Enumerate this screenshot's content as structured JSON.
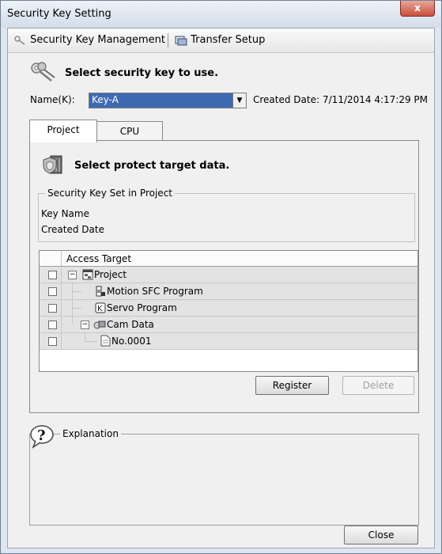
{
  "window": {
    "title": "Security Key Setting",
    "close_glyph": "x"
  },
  "toolbar": {
    "items": [
      {
        "label": "Security Key Management",
        "icon": "key-icon"
      },
      {
        "label": "Transfer Setup",
        "icon": "transfer-icon"
      }
    ]
  },
  "key_section": {
    "heading": "Select security key to use.",
    "name_label": "Name(K):",
    "name_value": "Key-A",
    "created_label": "Created Date:",
    "created_value": "7/11/2014 4:17:29 PM"
  },
  "tabs": [
    {
      "label": "Project",
      "selected": true
    },
    {
      "label": "CPU",
      "selected": false
    }
  ],
  "project_tab": {
    "heading": "Select protect target data.",
    "group_title": "Security Key Set in Project",
    "key_name_label": "Key Name",
    "created_date_label": "Created Date",
    "tree_header": "Access Target",
    "tree_rows": [
      {
        "label": "Project",
        "level": 0,
        "expander": "−",
        "icon": "project-icon"
      },
      {
        "label": "Motion SFC Program",
        "level": 1,
        "expander": "",
        "icon": "sfc-icon"
      },
      {
        "label": "Servo Program",
        "level": 1,
        "expander": "",
        "icon": "servo-icon"
      },
      {
        "label": "Cam Data",
        "level": 1,
        "expander": "−",
        "icon": "cam-icon"
      },
      {
        "label": "No.0001",
        "level": 2,
        "expander": "",
        "icon": "document-icon"
      }
    ],
    "register_label": "Register",
    "delete_label": "Delete"
  },
  "explanation": {
    "title": "Explanation"
  },
  "close_label": "Close",
  "colors": {
    "selection": "#3d6ab3",
    "title_gradient_top": "#eef3f9",
    "close_button": "#c9503c"
  }
}
